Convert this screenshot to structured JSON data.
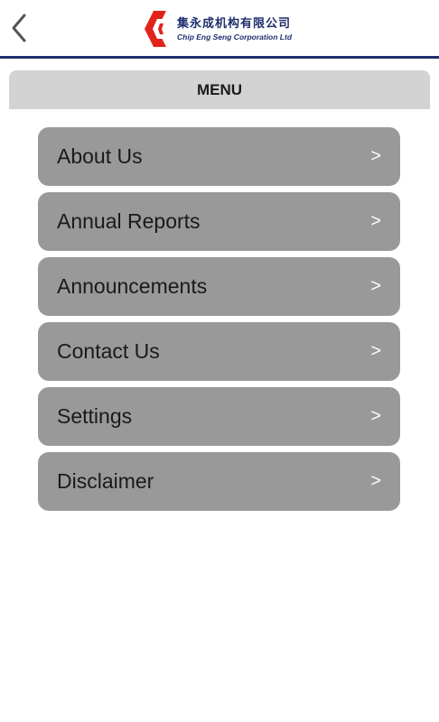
{
  "header": {
    "logo_cn": "集永成机构有限公司",
    "logo_en": "Chip Eng Seng Corporation Ltd",
    "back_icon": "chevron-left-icon",
    "brand_color": "#1f2f6e",
    "logo_accent": "#e2231a"
  },
  "menu": {
    "title": "MENU",
    "items": [
      {
        "label": "About Us",
        "arrow": ">"
      },
      {
        "label": "Annual Reports",
        "arrow": ">"
      },
      {
        "label": "Announcements",
        "arrow": ">"
      },
      {
        "label": "Contact Us",
        "arrow": ">"
      },
      {
        "label": "Settings",
        "arrow": ">"
      },
      {
        "label": "Disclaimer",
        "arrow": ">"
      }
    ]
  }
}
